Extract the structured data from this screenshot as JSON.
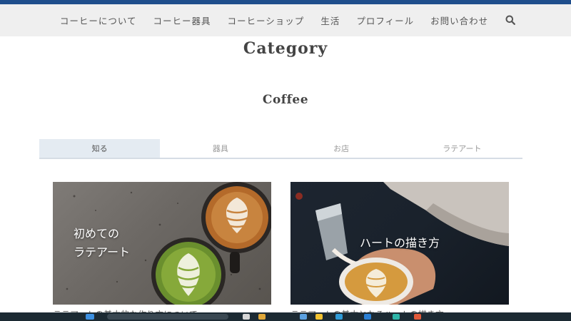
{
  "nav": {
    "items": [
      "コーヒーについて",
      "コーヒー器具",
      "コーヒーショップ",
      "生活",
      "プロフィール",
      "お問い合わせ"
    ],
    "search_icon": "search-icon"
  },
  "page": {
    "title": "Category",
    "subtitle": "Coffee"
  },
  "tabs": [
    {
      "label": "知る",
      "active": true
    },
    {
      "label": "器具",
      "active": false
    },
    {
      "label": "お店",
      "active": false
    },
    {
      "label": "ラテアート",
      "active": false
    }
  ],
  "cards": [
    {
      "label": "初めての\nラテアート",
      "caption": "ラテアートの基本的な作り方について"
    },
    {
      "label": "ハートの描き方",
      "caption": "ラテアートの基本となるハートの描き方"
    }
  ],
  "colors": {
    "top_bar": "#1f4e8c",
    "nav_bg": "#efefef",
    "active_tab_bg": "#e4ebf2",
    "taskbar": "#1c2a33"
  }
}
